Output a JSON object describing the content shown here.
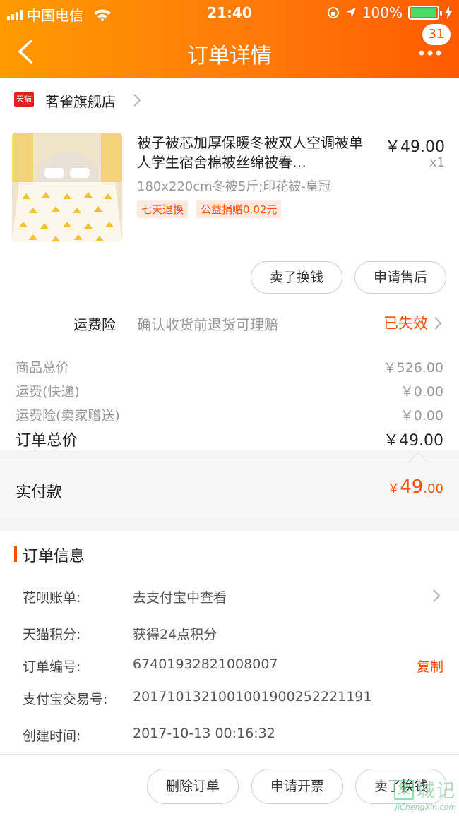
{
  "status_bar": {
    "carrier": "中国电信",
    "time": "21:40",
    "battery": "100%"
  },
  "nav": {
    "title": "订单详情",
    "badge_count": "31"
  },
  "store": {
    "logo_text": "天猫",
    "name": "茗雀旗舰店"
  },
  "product": {
    "title": "被子被芯加厚保暖冬被双人空调被单人学生宿舍棉被丝绵被春…",
    "price": "￥49.00",
    "quantity": "x1",
    "spec": "180x220cm冬被5斤;印花被-皇冠",
    "tags": [
      "七天退换",
      "公益捐赠0.02元"
    ]
  },
  "item_actions": {
    "sell": "卖了换钱",
    "after_sale": "申请售后"
  },
  "insurance": {
    "label": "运费险",
    "desc": "确认收货前退货可理赔",
    "status": "已失效"
  },
  "fees": [
    {
      "label": "商品总价",
      "value": "￥526.00"
    },
    {
      "label": "运费(快递)",
      "value": "￥0.00"
    },
    {
      "label": "运费险(卖家赠送)",
      "value": "￥0.00"
    }
  ],
  "order_total": {
    "label": "订单总价",
    "value": "￥49.00"
  },
  "paid": {
    "label": "实付款",
    "currency": "￥",
    "integer": "49",
    "decimal": ".00"
  },
  "order_info": {
    "title": "订单信息",
    "rows": [
      {
        "key": "花呗账单:",
        "value": "去支付宝中查看"
      },
      {
        "key": "天猫积分:",
        "value": "获得24点积分"
      },
      {
        "key": "订单编号:",
        "value": "67401932821008007",
        "action": "复制"
      },
      {
        "key": "支付宝交易号:",
        "value": "2017101321001001900252221191"
      },
      {
        "key": "创建时间:",
        "value": "2017-10-13 00:16:32"
      }
    ]
  },
  "bottom_actions": {
    "delete": "删除订单",
    "invoice": "申请开票",
    "sell": "卖了换钱"
  },
  "watermark": {
    "box": "集",
    "text": "城记",
    "url": "JiChengXin.com"
  },
  "colors": {
    "accent": "#ff5000",
    "header_start": "#ff9a00",
    "header_end": "#ff5a00"
  }
}
